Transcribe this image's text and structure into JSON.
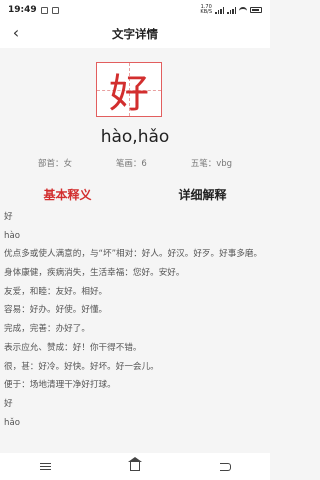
{
  "status": {
    "time": "19:49",
    "speed_value": "1.70",
    "speed_unit": "KB/S",
    "battery": "4G"
  },
  "header": {
    "title": "文字详情",
    "back_icon": "‹"
  },
  "character": {
    "glyph": "好",
    "pinyin": "hào,hǎo",
    "radical": "部首：女",
    "strokes": "笔画：6",
    "wubi": "五笔：vbg"
  },
  "tabs": {
    "basic": "基本释义",
    "detailed": "详细解释"
  },
  "content": [
    "好",
    "hào",
    "优点多或使人满意的，与“坏”相对：好人。好汉。好歹。好事多磨。",
    "身体康健，疾病消失，生活幸福：您好。安好。",
    "友爱，和睦：友好。相好。",
    "容易：好办。好使。好懂。",
    "完成，完善：办好了。",
    "表示应允、赞成：好！你干得不错。",
    "很，甚：好冷。好快。好坏。好一会儿。",
    "便于：场地清理干净好打球。",
    "好",
    "hǎo"
  ],
  "icons": {
    "back": "back-icon",
    "nav_menu": "menu-icon",
    "nav_home": "home-icon",
    "nav_back": "back-nav-icon"
  }
}
